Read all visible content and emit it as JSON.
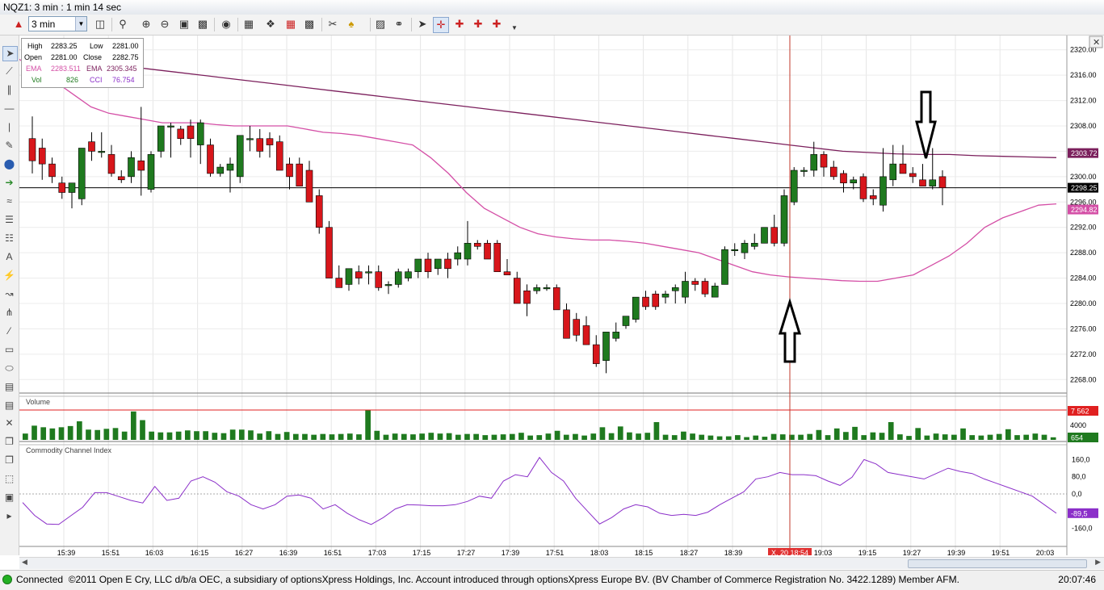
{
  "window": {
    "title": "NQZ1: 3 min : 1 min 14 sec"
  },
  "toolbar": {
    "timeframe_value": "3 min"
  },
  "info_box": {
    "high_label": "High",
    "high": "2283.25",
    "low_label": "Low",
    "low": "2281.00",
    "open_label": "Open",
    "open": "2281.00",
    "close_label": "Close",
    "close": "2282.75",
    "ema1_label": "EMA",
    "ema1": "2283.511",
    "ema2_label": "EMA",
    "ema2": "2305.345",
    "vol_label": "Vol",
    "vol": "826",
    "cci_label": "CCI",
    "cci": "76.754"
  },
  "panels": {
    "volume_title": "Volume",
    "cci_title": "Commodity Channel Index"
  },
  "price_axis": {
    "labels": [
      "2320.00",
      "2316.00",
      "2312.00",
      "2308.00",
      "2304.00",
      "2300.00",
      "2296.00",
      "2292.00",
      "2288.00",
      "2284.00",
      "2280.00",
      "2276.00",
      "2272.00",
      "2268.00"
    ]
  },
  "price_badges": {
    "ema_slow": "2303.72",
    "last": "2298.25",
    "ema_fast": "2294.82"
  },
  "volume_axis": {
    "mid": "4000",
    "max_badge": "7 562",
    "last_badge": "654"
  },
  "cci_axis": {
    "labels": [
      "160,0",
      "80,0",
      "0,0",
      "-160,0"
    ],
    "last_badge": "-89,5"
  },
  "time_axis": {
    "labels": [
      "15:39",
      "15:51",
      "16:03",
      "16:15",
      "16:27",
      "16:39",
      "16:51",
      "17:03",
      "17:15",
      "17:27",
      "17:39",
      "17:51",
      "18:03",
      "18:15",
      "18:27",
      "18:39",
      "19:03",
      "19:15",
      "19:27",
      "19:39",
      "19:51",
      "20:03"
    ],
    "cursor_label": "X, 20 18:54"
  },
  "colors": {
    "up": "#1f7a1f",
    "down": "#d8161b",
    "ema_fast": "#d44fa6",
    "ema_slow": "#7b1f5c",
    "cci": "#8b2fc9",
    "cursor": "#c0392b"
  },
  "status": {
    "connection": "Connected",
    "text": "©2011 Open E Cry, LLC d/b/a OEC, a subsidiary of optionsXpress Holdings, Inc. Account introduced through optionsXpress Europe BV. (BV Chamber of Commerce Registration No. 3422.1289) Member AFM.",
    "time": "20:07:46"
  },
  "chart_data": {
    "type": "candlestick",
    "instrument": "NQZ1",
    "interval": "3 min",
    "ylim": [
      2266,
      2322
    ],
    "candles": [
      {
        "o": 2306,
        "h": 2309.5,
        "l": 2300.5,
        "c": 2302.5
      },
      {
        "o": 2304.5,
        "h": 2306,
        "l": 2299.5,
        "c": 2302
      },
      {
        "o": 2302,
        "h": 2303,
        "l": 2299,
        "c": 2300
      },
      {
        "o": 2299,
        "h": 2300,
        "l": 2296.5,
        "c": 2297.5
      },
      {
        "o": 2297.5,
        "h": 2299,
        "l": 2295,
        "c": 2299
      },
      {
        "o": 2296.5,
        "h": 2304,
        "l": 2295.5,
        "c": 2304.5
      },
      {
        "o": 2305.5,
        "h": 2307,
        "l": 2302.5,
        "c": 2304
      },
      {
        "o": 2304,
        "h": 2307,
        "l": 2303,
        "c": 2304
      },
      {
        "o": 2303.5,
        "h": 2305,
        "l": 2300,
        "c": 2300.5
      },
      {
        "o": 2300,
        "h": 2301,
        "l": 2299,
        "c": 2299.5
      },
      {
        "o": 2300,
        "h": 2304,
        "l": 2299,
        "c": 2303
      },
      {
        "o": 2302.5,
        "h": 2311,
        "l": 2297,
        "c": 2301
      },
      {
        "o": 2298,
        "h": 2304,
        "l": 2297.5,
        "c": 2303.5
      },
      {
        "o": 2304,
        "h": 2308,
        "l": 2303,
        "c": 2308
      },
      {
        "o": 2308,
        "h": 2308.5,
        "l": 2303,
        "c": 2308
      },
      {
        "o": 2307.5,
        "h": 2308,
        "l": 2305,
        "c": 2306
      },
      {
        "o": 2308,
        "h": 2309,
        "l": 2303,
        "c": 2306
      },
      {
        "o": 2305,
        "h": 2309,
        "l": 2302,
        "c": 2308.5
      },
      {
        "o": 2305,
        "h": 2306,
        "l": 2300,
        "c": 2300.5
      },
      {
        "o": 2300.5,
        "h": 2302,
        "l": 2300,
        "c": 2301.5
      },
      {
        "o": 2301,
        "h": 2303,
        "l": 2297.5,
        "c": 2302
      },
      {
        "o": 2300,
        "h": 2306,
        "l": 2299,
        "c": 2306.5
      },
      {
        "o": 2306,
        "h": 2308,
        "l": 2304,
        "c": 2306
      },
      {
        "o": 2306,
        "h": 2307.5,
        "l": 2303,
        "c": 2304
      },
      {
        "o": 2306,
        "h": 2307,
        "l": 2303,
        "c": 2305
      },
      {
        "o": 2305.5,
        "h": 2306.5,
        "l": 2302,
        "c": 2301
      },
      {
        "o": 2302,
        "h": 2303,
        "l": 2298,
        "c": 2300
      },
      {
        "o": 2302,
        "h": 2303,
        "l": 2299,
        "c": 2298.5
      },
      {
        "o": 2301,
        "h": 2302.5,
        "l": 2298,
        "c": 2296
      },
      {
        "o": 2297,
        "h": 2298,
        "l": 2291,
        "c": 2292
      },
      {
        "o": 2292,
        "h": 2293,
        "l": 2284,
        "c": 2284
      },
      {
        "o": 2284,
        "h": 2286,
        "l": 2282.5,
        "c": 2282.5
      },
      {
        "o": 2283,
        "h": 2285.5,
        "l": 2282,
        "c": 2285.5
      },
      {
        "o": 2285,
        "h": 2286,
        "l": 2283,
        "c": 2284
      },
      {
        "o": 2285,
        "h": 2286,
        "l": 2283,
        "c": 2285
      },
      {
        "o": 2285,
        "h": 2286,
        "l": 2282,
        "c": 2282.5
      },
      {
        "o": 2283,
        "h": 2283.5,
        "l": 2281.5,
        "c": 2283
      },
      {
        "o": 2283,
        "h": 2285.5,
        "l": 2282.5,
        "c": 2285
      },
      {
        "o": 2284,
        "h": 2285.5,
        "l": 2283.5,
        "c": 2285
      },
      {
        "o": 2285,
        "h": 2287,
        "l": 2284,
        "c": 2287
      },
      {
        "o": 2287,
        "h": 2288,
        "l": 2284,
        "c": 2285
      },
      {
        "o": 2285.5,
        "h": 2287,
        "l": 2284.5,
        "c": 2287
      },
      {
        "o": 2287,
        "h": 2288,
        "l": 2284,
        "c": 2285.5
      },
      {
        "o": 2287,
        "h": 2289,
        "l": 2286,
        "c": 2288
      },
      {
        "o": 2287,
        "h": 2293,
        "l": 2286,
        "c": 2289.5
      },
      {
        "o": 2289.5,
        "h": 2290,
        "l": 2288.5,
        "c": 2289
      },
      {
        "o": 2289.5,
        "h": 2290,
        "l": 2287,
        "c": 2287
      },
      {
        "o": 2289.5,
        "h": 2290,
        "l": 2286,
        "c": 2285
      },
      {
        "o": 2285,
        "h": 2287,
        "l": 2284.5,
        "c": 2284.5
      },
      {
        "o": 2284,
        "h": 2285,
        "l": 2281,
        "c": 2280
      },
      {
        "o": 2282,
        "h": 2283,
        "l": 2278,
        "c": 2280
      },
      {
        "o": 2282,
        "h": 2283,
        "l": 2281.5,
        "c": 2282.5
      },
      {
        "o": 2282.5,
        "h": 2283,
        "l": 2282,
        "c": 2282.5
      },
      {
        "o": 2282.5,
        "h": 2283,
        "l": 2279,
        "c": 2279
      },
      {
        "o": 2279,
        "h": 2280,
        "l": 2275,
        "c": 2274.5
      },
      {
        "o": 2277.5,
        "h": 2278.5,
        "l": 2274,
        "c": 2275
      },
      {
        "o": 2276.5,
        "h": 2278,
        "l": 2273.5,
        "c": 2273.5
      },
      {
        "o": 2273.5,
        "h": 2275,
        "l": 2270,
        "c": 2270.5
      },
      {
        "o": 2271,
        "h": 2275,
        "l": 2269,
        "c": 2275.5
      },
      {
        "o": 2274.5,
        "h": 2277,
        "l": 2274,
        "c": 2275.5
      },
      {
        "o": 2276.5,
        "h": 2278,
        "l": 2276,
        "c": 2278
      },
      {
        "o": 2277.5,
        "h": 2281,
        "l": 2277,
        "c": 2281
      },
      {
        "o": 2281,
        "h": 2282,
        "l": 2279,
        "c": 2279.5
      },
      {
        "o": 2281.5,
        "h": 2282,
        "l": 2279,
        "c": 2279.5
      },
      {
        "o": 2281,
        "h": 2282,
        "l": 2280,
        "c": 2281.5
      },
      {
        "o": 2282,
        "h": 2283,
        "l": 2280,
        "c": 2282.5
      },
      {
        "o": 2281,
        "h": 2285,
        "l": 2280,
        "c": 2283.5
      },
      {
        "o": 2283.5,
        "h": 2284,
        "l": 2282,
        "c": 2283
      },
      {
        "o": 2283.5,
        "h": 2284,
        "l": 2281,
        "c": 2281.5
      },
      {
        "o": 2281,
        "h": 2283.25,
        "l": 2281,
        "c": 2282.75
      },
      {
        "o": 2283,
        "h": 2289,
        "l": 2283,
        "c": 2288.5
      },
      {
        "o": 2288.5,
        "h": 2289.5,
        "l": 2287.5,
        "c": 2288.5
      },
      {
        "o": 2288,
        "h": 2290,
        "l": 2287,
        "c": 2289.5
      },
      {
        "o": 2289,
        "h": 2291,
        "l": 2288.5,
        "c": 2289.5
      },
      {
        "o": 2289.5,
        "h": 2292,
        "l": 2289.5,
        "c": 2292
      },
      {
        "o": 2292,
        "h": 2294,
        "l": 2289,
        "c": 2289.5
      },
      {
        "o": 2289.5,
        "h": 2298,
        "l": 2289,
        "c": 2297
      },
      {
        "o": 2296,
        "h": 2301.5,
        "l": 2295.5,
        "c": 2301
      },
      {
        "o": 2301,
        "h": 2301.5,
        "l": 2300,
        "c": 2301
      },
      {
        "o": 2301,
        "h": 2305.5,
        "l": 2300,
        "c": 2303.5
      },
      {
        "o": 2303.5,
        "h": 2304,
        "l": 2300,
        "c": 2301.5
      },
      {
        "o": 2301.5,
        "h": 2302.5,
        "l": 2299.5,
        "c": 2300
      },
      {
        "o": 2300.5,
        "h": 2301,
        "l": 2297.5,
        "c": 2299
      },
      {
        "o": 2299,
        "h": 2300,
        "l": 2298,
        "c": 2299.5
      },
      {
        "o": 2300,
        "h": 2300.5,
        "l": 2296,
        "c": 2296.5
      },
      {
        "o": 2297,
        "h": 2298,
        "l": 2295.5,
        "c": 2296.5
      },
      {
        "o": 2295.5,
        "h": 2304.5,
        "l": 2294.5,
        "c": 2300
      },
      {
        "o": 2299.5,
        "h": 2305,
        "l": 2298.5,
        "c": 2302
      },
      {
        "o": 2302,
        "h": 2305,
        "l": 2300.5,
        "c": 2300.5
      },
      {
        "o": 2300.5,
        "h": 2301.5,
        "l": 2299,
        "c": 2300
      },
      {
        "o": 2299.5,
        "h": 2302,
        "l": 2298.5,
        "c": 2298.5
      },
      {
        "o": 2298.5,
        "h": 2304.5,
        "l": 2298,
        "c": 2299.5
      },
      {
        "o": 2300,
        "h": 2301,
        "l": 2295.5,
        "c": 2298.25
      }
    ],
    "volume": [
      1600,
      3600,
      3200,
      2900,
      3200,
      3500,
      4700,
      2600,
      2500,
      2800,
      3000,
      2100,
      7200,
      5000,
      2100,
      1900,
      1900,
      2100,
      2400,
      2200,
      2200,
      1800,
      1700,
      2600,
      2600,
      2400,
      1600,
      2200,
      1500,
      2000,
      1500,
      1500,
      1300,
      1500,
      1400,
      1500,
      1600,
      1400,
      7562,
      2300,
      1300,
      1600,
      1500,
      1400,
      1600,
      1800,
      1600,
      1700,
      1300,
      1500,
      1500,
      1200,
      1300,
      1400,
      1500,
      1800,
      1100,
      1200,
      1600,
      2300,
      1300,
      1500,
      1100,
      1600,
      3200,
      1700,
      3400,
      1900,
      1600,
      1800,
      4500,
      1300,
      1200,
      2100,
      1600,
      1300,
      1100,
      900,
      900,
      1200,
      700,
      1100,
      800,
      1500,
      1400,
      1300,
      1300,
      1500,
      2500,
      1200,
      2900,
      2000,
      3300,
      1200,
      1900,
      1800,
      4500,
      1400,
      1000,
      3000,
      1100,
      1600,
      1400,
      1300,
      2900,
      1200,
      1100,
      1300,
      1500,
      2700,
      1200,
      1300,
      1600,
      1300,
      654
    ],
    "cci": [
      -40,
      -100,
      -140,
      -142,
      -102,
      -62,
      6,
      6,
      -12,
      -30,
      -42,
      35,
      -30,
      -20,
      60,
      80,
      55,
      10,
      -10,
      -50,
      -70,
      -50,
      -10,
      -5,
      -20,
      -70,
      -50,
      -90,
      -120,
      -142,
      -110,
      -70,
      -50,
      -52,
      -55,
      -55,
      -50,
      -35,
      -10,
      -20,
      60,
      90,
      80,
      170,
      100,
      60,
      -20,
      -80,
      -140,
      -110,
      -70,
      -50,
      -60,
      -90,
      -100,
      -95,
      -100,
      -85,
      -50,
      -20,
      10,
      70,
      80,
      100,
      90,
      90,
      85,
      60,
      40,
      78,
      160,
      140,
      100,
      90,
      80,
      70,
      95,
      120,
      105,
      95,
      70,
      50,
      30,
      10,
      -10,
      -50,
      -90
    ],
    "ema_fast": [
      2318.5,
      2316.5,
      2315,
      2313,
      2311,
      2310,
      2309.5,
      2309,
      2308.5,
      2308.5,
      2308.5,
      2308.2,
      2308,
      2308,
      2308,
      2308,
      2307.5,
      2307,
      2306.8,
      2306.5,
      2306,
      2305.5,
      2305,
      2303,
      2300.5,
      2297.5,
      2295,
      2293.5,
      2292,
      2291,
      2290.5,
      2290.2,
      2290,
      2290,
      2289.8,
      2289.5,
      2289,
      2288.5,
      2288,
      2287,
      2286,
      2285,
      2284.5,
      2284.2,
      2284,
      2283.8,
      2283.6,
      2283.5,
      2283.5,
      2284,
      2284.5,
      2286,
      2287.5,
      2289.5,
      2292,
      2293.5,
      2294.5,
      2295.5,
      2295.7
    ],
    "ema_slow": [
      2318.5,
      2318,
      2317.5,
      2317,
      2316.5,
      2316,
      2315.5,
      2315,
      2314.5,
      2314,
      2313.5,
      2313,
      2312.5,
      2312,
      2311.5,
      2311,
      2310.5,
      2310,
      2309.5,
      2309,
      2308.5,
      2308,
      2307.5,
      2307,
      2306.5,
      2306,
      2305.5,
      2305,
      2304.5,
      2304,
      2303.8,
      2303.6,
      2303.5,
      2303.5,
      2303.3,
      2303.2,
      2303.1,
      2303
    ],
    "last_price": 2298.25
  }
}
